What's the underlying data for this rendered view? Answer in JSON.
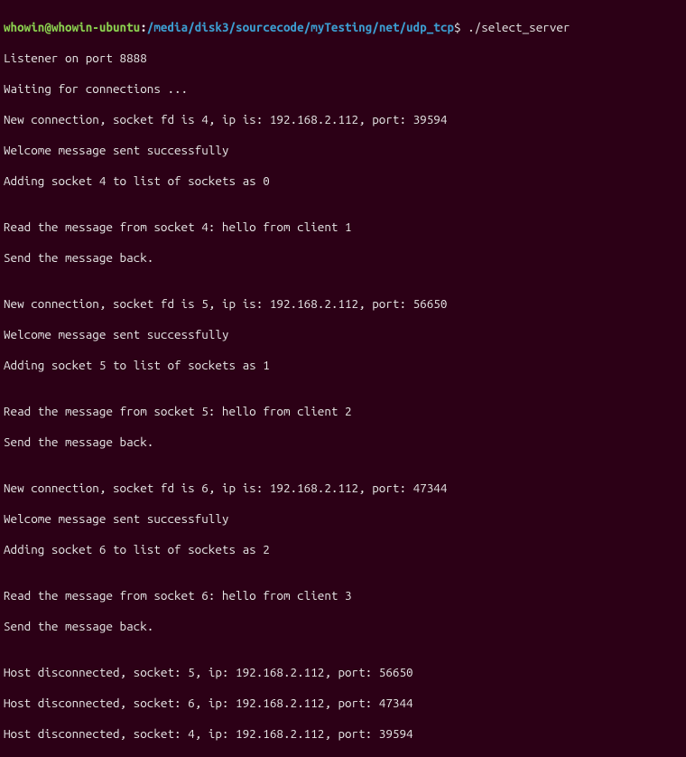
{
  "prompt": {
    "user": "whowin",
    "at": "@",
    "host": "whowin-ubuntu",
    "sep": ":",
    "path": "/media/disk3/sourcecode/myTesting/net/udp_tcp",
    "dollar": "$ ",
    "command": "./select_server"
  },
  "lines": [
    "Listener on port 8888",
    "Waiting for connections ...",
    "New connection, socket fd is 4, ip is: 192.168.2.112, port: 39594",
    "Welcome message sent successfully",
    "Adding socket 4 to list of sockets as 0",
    "",
    "Read the message from socket 4: hello from client 1",
    "Send the message back.",
    "",
    "New connection, socket fd is 5, ip is: 192.168.2.112, port: 56650",
    "Welcome message sent successfully",
    "Adding socket 5 to list of sockets as 1",
    "",
    "Read the message from socket 5: hello from client 2",
    "Send the message back.",
    "",
    "New connection, socket fd is 6, ip is: 192.168.2.112, port: 47344",
    "Welcome message sent successfully",
    "Adding socket 6 to list of sockets as 2",
    "",
    "Read the message from socket 6: hello from client 3",
    "Send the message back.",
    "",
    "Host disconnected, socket: 5, ip: 192.168.2.112, port: 56650",
    "Host disconnected, socket: 6, ip: 192.168.2.112, port: 47344",
    "Host disconnected, socket: 4, ip: 192.168.2.112, port: 39594"
  ]
}
